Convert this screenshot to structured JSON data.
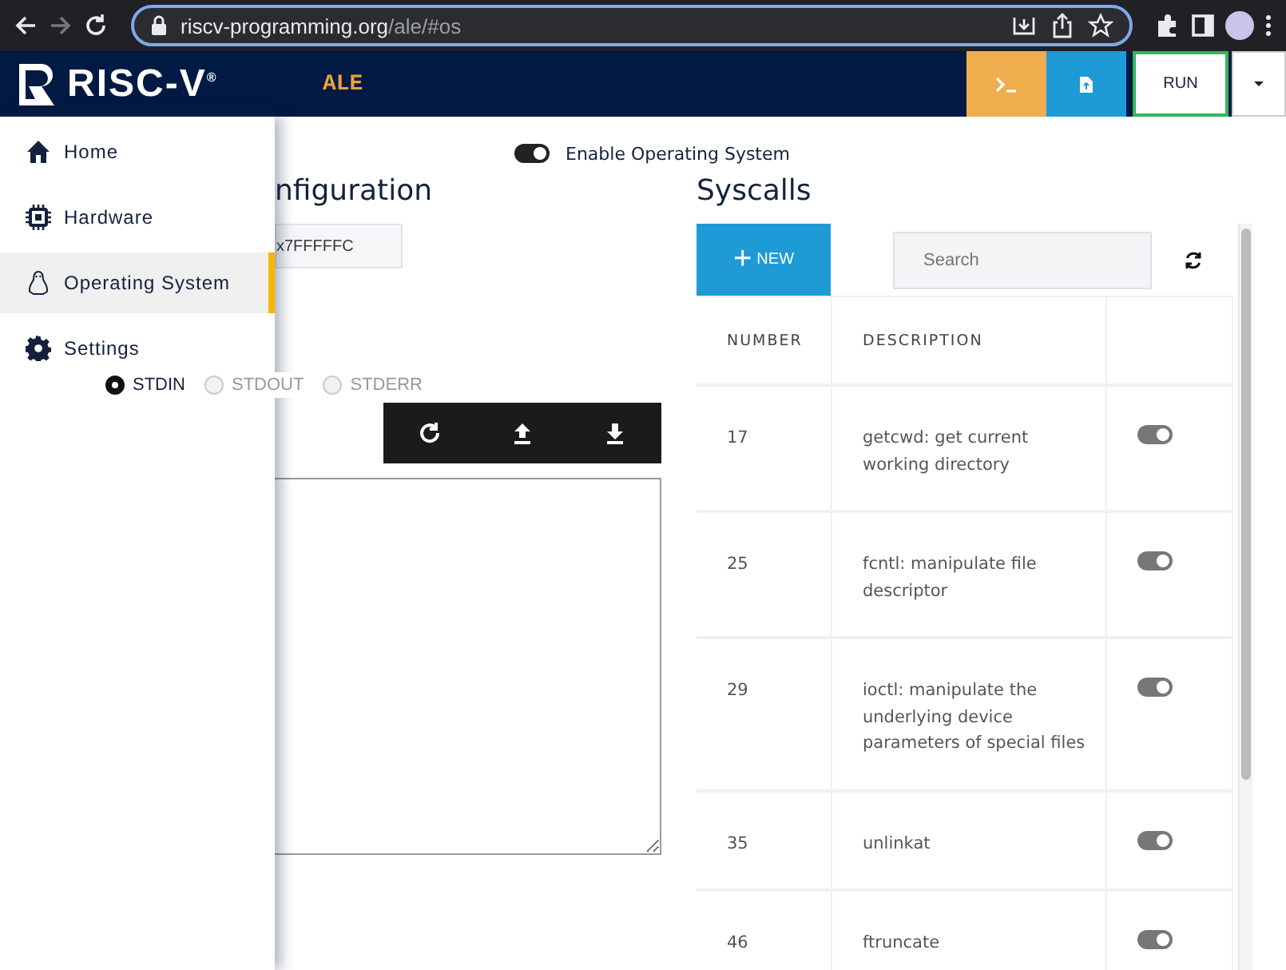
{
  "browser": {
    "url_host": "riscv-programming.org",
    "url_path": "/ale/#os"
  },
  "header": {
    "logo": "RISC-V",
    "logo_mark": "®",
    "app_name": "ALE",
    "run_label": "RUN"
  },
  "sidebar": {
    "items": [
      {
        "label": "Home",
        "selected": false
      },
      {
        "label": "Hardware",
        "selected": false
      },
      {
        "label": "Operating System",
        "selected": true
      },
      {
        "label": "Settings",
        "selected": false
      }
    ],
    "streams": [
      {
        "label": "STDIN",
        "selected": true
      },
      {
        "label": "STDOUT",
        "selected": false
      },
      {
        "label": "STDERR",
        "selected": false
      }
    ]
  },
  "config": {
    "enable_os": {
      "label": "Enable Operating System",
      "on": true
    },
    "title": "nfiguration",
    "stack_value": "x7FFFFFC"
  },
  "syscalls": {
    "title": "Syscalls",
    "new_label": "NEW",
    "new_plus": "+",
    "search_placeholder": "Search",
    "columns": [
      "NUMBER",
      "DESCRIPTION"
    ],
    "rows": [
      {
        "number": "17",
        "description": "getcwd: get current working directory",
        "on": true
      },
      {
        "number": "25",
        "description": "fcntl: manipulate file descriptor",
        "on": true
      },
      {
        "number": "29",
        "description": "ioctl: manipulate the underlying device parameters of special files",
        "on": true
      },
      {
        "number": "35",
        "description": "unlinkat",
        "on": true
      },
      {
        "number": "46",
        "description": "ftruncate",
        "on": true
      }
    ]
  }
}
